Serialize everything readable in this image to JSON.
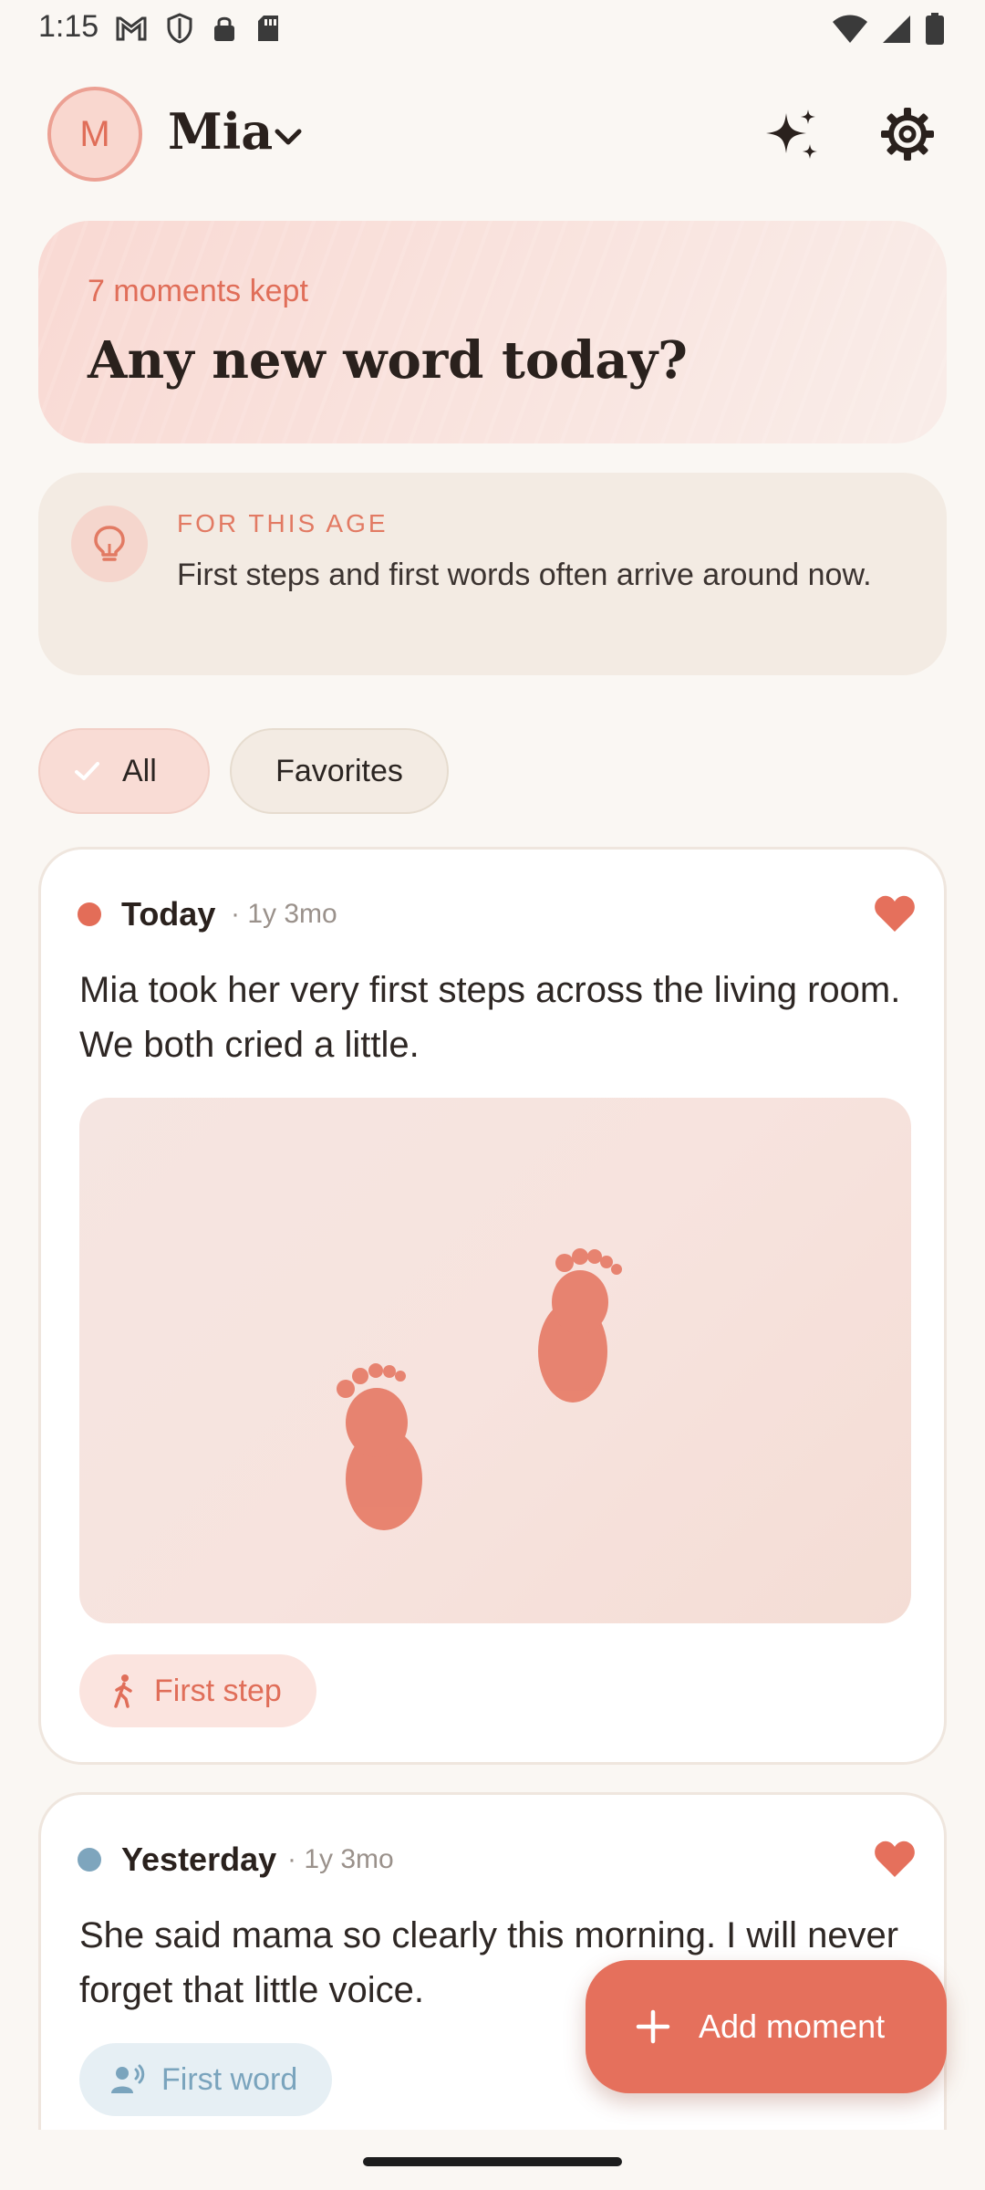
{
  "status_bar": {
    "time": "1:15",
    "left_icons": [
      "gmail-icon",
      "shield-icon",
      "lock-icon",
      "sd-card-icon"
    ],
    "right_icons": [
      "wifi-icon",
      "signal-icon",
      "battery-icon"
    ]
  },
  "header": {
    "avatar_initial": "M",
    "profile_name": "Mia",
    "actions": [
      "sparkle-icon",
      "gear-icon"
    ]
  },
  "hero": {
    "count_text": "7 moments kept",
    "question": "Any new word today?"
  },
  "tip": {
    "label": "FOR THIS AGE",
    "text": "First steps and first words often arrive around now.",
    "icon": "lightbulb-icon"
  },
  "filters": {
    "all_label": "All",
    "favorites_label": "Favorites",
    "selected": "All"
  },
  "moments": [
    {
      "date": "Today",
      "age": "· 1y 3mo",
      "text": "Mia took her very first steps across the living room. We both cried a little.",
      "favorite": true,
      "dot_color": "#e36d58",
      "photo_icon": "footprints-illustration",
      "tag": "First step",
      "tag_icon": "walking-icon"
    },
    {
      "date": "Yesterday",
      "age": "· 1y 3mo",
      "text": "She said mama so clearly this morning. I will never forget that little voice.",
      "favorite": true,
      "dot_color": "#7ea5bd",
      "tag": "First word",
      "tag_icon": "speaking-icon"
    }
  ],
  "fab": {
    "label": "Add moment",
    "icon": "plus-icon"
  },
  "colors": {
    "accent": "#e5705c",
    "background": "#faf7f3",
    "blue_tag": "#7aa4bd"
  }
}
